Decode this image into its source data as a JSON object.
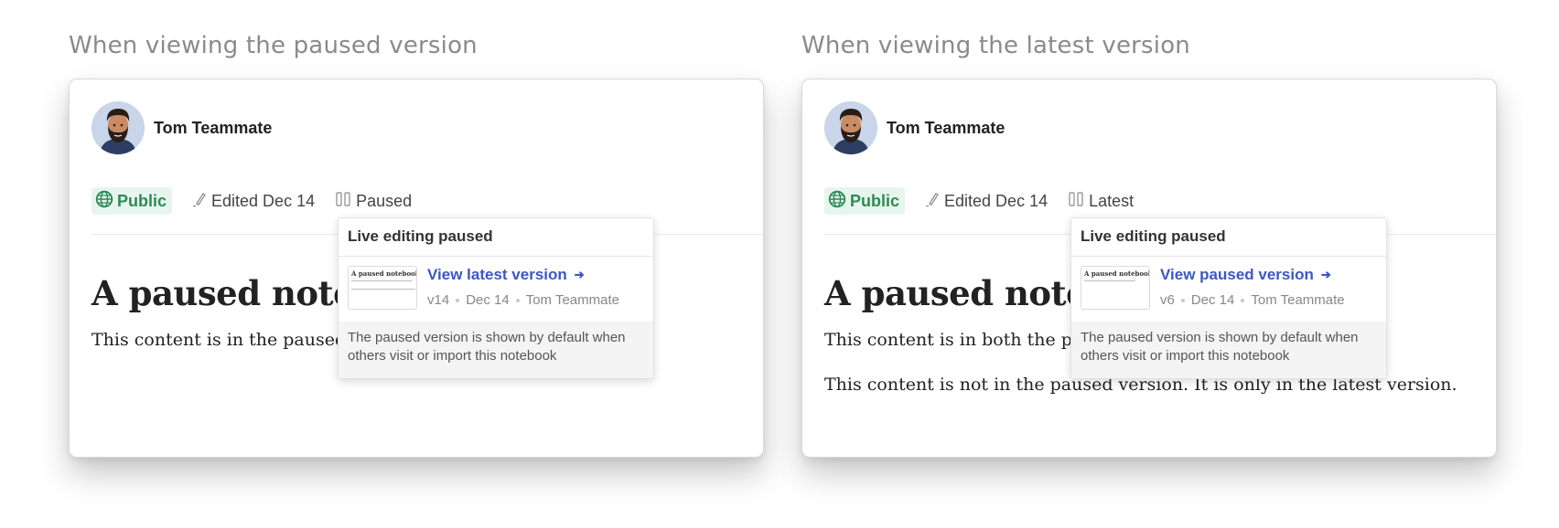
{
  "panels": [
    {
      "caption": "When viewing the paused version",
      "author": "Tom Teammate",
      "visibility": "Public",
      "edited": "Edited Dec 14",
      "status": "Paused",
      "doc_title": "A paused notebook",
      "paragraphs": [
        "This content is in the paused version."
      ],
      "popover": {
        "title": "Live editing paused",
        "link_label": "View latest version",
        "version": "v14",
        "date": "Dec 14",
        "author": "Tom Teammate",
        "thumb_title": "A paused notebook",
        "note": "The paused version is shown by default when others visit or import this notebook"
      }
    },
    {
      "caption": "When viewing the latest version",
      "author": "Tom Teammate",
      "visibility": "Public",
      "edited": "Edited Dec 14",
      "status": "Latest",
      "doc_title": "A paused notebook",
      "paragraphs": [
        "This content is in both the paused and latest versions.",
        "This content is not in the paused version. It is only in the latest version."
      ],
      "popover": {
        "title": "Live editing paused",
        "link_label": "View paused version",
        "version": "v6",
        "date": "Dec 14",
        "author": "Tom Teammate",
        "thumb_title": "A paused notebook",
        "note": "The paused version is shown by default when others visit or import this notebook"
      }
    }
  ],
  "colors": {
    "accent_link": "#3a57c4",
    "public_badge": "#2e8a55"
  },
  "icons": {
    "visibility": "globe-icon",
    "edited": "pencil-icon",
    "status": "pause-icon",
    "link": "arrow-right-icon"
  }
}
